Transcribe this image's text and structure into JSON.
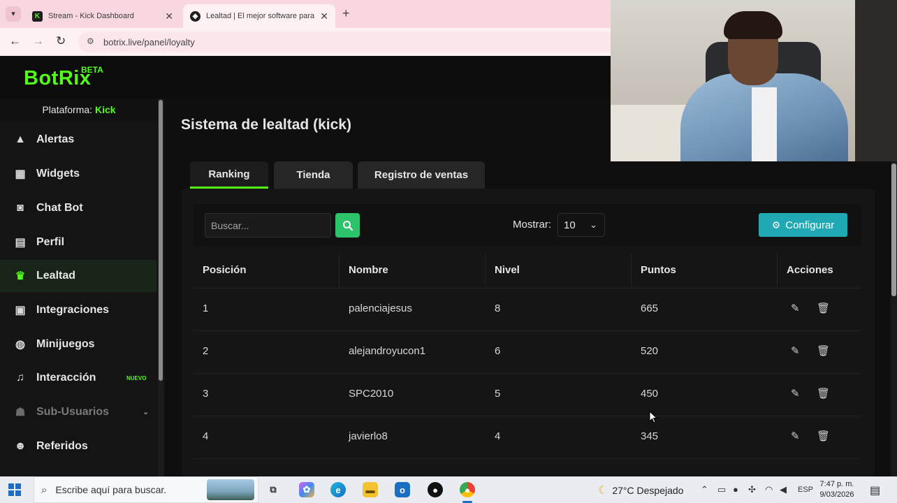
{
  "browser": {
    "tabs": [
      {
        "title": "Stream - Kick Dashboard",
        "favicon": "kick-logo",
        "active": false
      },
      {
        "title": "Lealtad | El mejor software para",
        "favicon": "botrix-logo",
        "active": true
      }
    ],
    "new_tab": "+",
    "url": "botrix.live/panel/loyalty"
  },
  "app": {
    "logo": "BotRix",
    "logo_badge": "BETA",
    "brand_color": "#53fc18"
  },
  "sidebar": {
    "platform_label": "Plataforma:",
    "platform_value": "Kick",
    "items": [
      {
        "label": "Alertas",
        "icon": "warning-icon"
      },
      {
        "label": "Widgets",
        "icon": "grid-icon"
      },
      {
        "label": "Chat Bot",
        "icon": "robot-icon"
      },
      {
        "label": "Perfil",
        "icon": "id-card-icon"
      },
      {
        "label": "Lealtad",
        "icon": "trophy-icon",
        "active": true
      },
      {
        "label": "Integraciones",
        "icon": "plug-icon"
      },
      {
        "label": "Minijuegos",
        "icon": "gamepad-icon"
      },
      {
        "label": "Interacción",
        "icon": "music-icon",
        "badge": "NUEVO"
      },
      {
        "label": "Sub-Usuarios",
        "icon": "users-icon",
        "disabled": true
      },
      {
        "label": "Referidos",
        "icon": "user-group-icon"
      }
    ]
  },
  "main": {
    "title": "Sistema de lealtad (kick)",
    "tabs": [
      {
        "label": "Ranking",
        "active": true
      },
      {
        "label": "Tienda"
      },
      {
        "label": "Registro de ventas"
      }
    ],
    "search": {
      "placeholder": "Buscar..."
    },
    "show_label": "Mostrar:",
    "show_value": "10",
    "configure_label": "Configurar",
    "table": {
      "headers": [
        "Posición",
        "Nombre",
        "Nivel",
        "Puntos",
        "Acciones"
      ],
      "rows": [
        {
          "pos": "1",
          "name": "palenciajesus",
          "level": "8",
          "points": "665"
        },
        {
          "pos": "2",
          "name": "alejandroyucon1",
          "level": "6",
          "points": "520"
        },
        {
          "pos": "3",
          "name": "SPC2010",
          "level": "5",
          "points": "450"
        },
        {
          "pos": "4",
          "name": "javierlo8",
          "level": "4",
          "points": "345"
        }
      ]
    }
  },
  "taskbar": {
    "search_placeholder": "Escribe aquí para buscar.",
    "weather": "27°C  Despejado",
    "language": "ESP",
    "time": "7:47 p. m.",
    "date": "9/03/2026"
  }
}
